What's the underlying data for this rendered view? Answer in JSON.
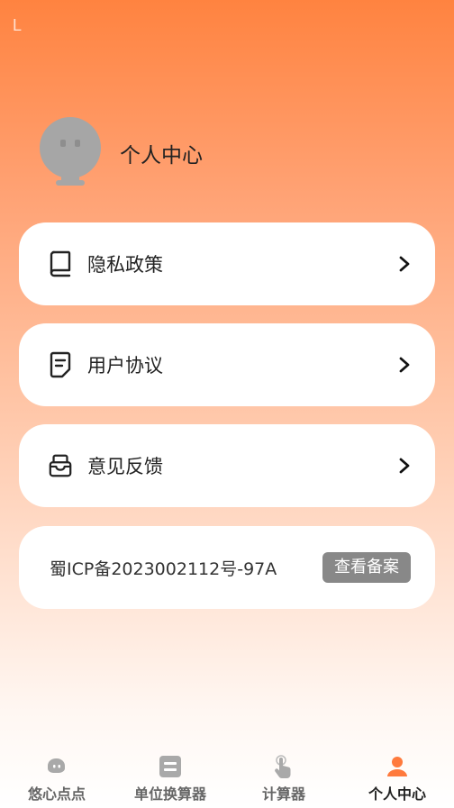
{
  "status_mark": "L",
  "profile": {
    "name": "个人中心"
  },
  "menu": [
    {
      "label": "隐私政策",
      "icon": "book-icon"
    },
    {
      "label": "用户协议",
      "icon": "document-icon"
    },
    {
      "label": "意见反馈",
      "icon": "inbox-icon"
    }
  ],
  "icp": {
    "text": "蜀ICP备2023002112号-97A",
    "button": "查看备案"
  },
  "tabs": [
    {
      "label": "悠心点点",
      "icon": "chat-bubble-icon",
      "active": false
    },
    {
      "label": "单位换算器",
      "icon": "converter-icon",
      "active": false
    },
    {
      "label": "计算器",
      "icon": "hand-tap-icon",
      "active": false
    },
    {
      "label": "个人中心",
      "icon": "user-icon",
      "active": true
    }
  ],
  "colors": {
    "accent": "#FF7A3D",
    "inactive_icon": "#A9A9A9",
    "button_gray": "#888888"
  }
}
